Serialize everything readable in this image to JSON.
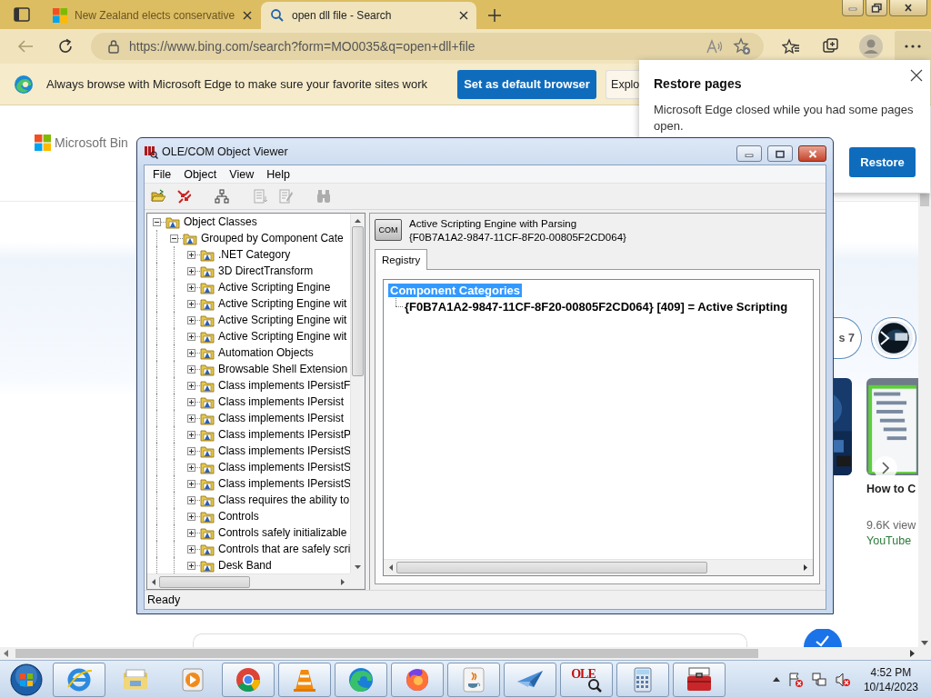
{
  "browser": {
    "tabs": [
      {
        "title": "New Zealand elects conservative",
        "kind": "news",
        "selected": false
      },
      {
        "title": "open dll file - Search",
        "kind": "search",
        "selected": true
      }
    ],
    "url": "https://www.bing.com/search?form=MO0035&q=open+dll+file",
    "info_bar": {
      "message": "Always browse with Microsoft Edge to make sure your favorite sites work",
      "buttons": [
        {
          "label": "Set as default browser",
          "kind": "primary"
        },
        {
          "label": "Explo",
          "kind": "secondary"
        }
      ]
    }
  },
  "restore_popup": {
    "title": "Restore pages",
    "message": "Microsoft Edge closed while you had some pages open.",
    "button": "Restore"
  },
  "page": {
    "logo": "Microsoft Bin",
    "pill": "s 7",
    "video": {
      "title": "How to C",
      "views": "9.6K view",
      "source": "YouTube"
    }
  },
  "ole_window": {
    "title": "OLE/COM Object Viewer",
    "menu": [
      "File",
      "Object",
      "View",
      "Help"
    ],
    "toolbar": [
      {
        "kind": "open-folder",
        "disabled": false
      },
      {
        "kind": "arrows",
        "disabled": false
      },
      {
        "kind": "hierarchy",
        "disabled": false
      },
      {
        "kind": "document",
        "disabled": true
      },
      {
        "kind": "document-edit",
        "disabled": true
      },
      {
        "kind": "binoculars",
        "disabled": true
      }
    ],
    "tree": [
      {
        "label": "Object Classes",
        "expanded": true,
        "children": [
          {
            "label": "Grouped by Component Cate",
            "expanded": true,
            "children": [
              {
                "label": ".NET Category",
                "expanded": false
              },
              {
                "label": "3D DirectTransform",
                "expanded": false
              },
              {
                "label": "Active Scripting Engine",
                "expanded": false
              },
              {
                "label": "Active Scripting Engine wit",
                "expanded": false
              },
              {
                "label": "Active Scripting Engine wit",
                "expanded": false
              },
              {
                "label": "Active Scripting Engine wit",
                "expanded": false
              },
              {
                "label": "Automation Objects",
                "expanded": false
              },
              {
                "label": "Browsable Shell Extension",
                "expanded": false
              },
              {
                "label": "Class implements IPersistF",
                "expanded": false
              },
              {
                "label": "Class implements IPersist",
                "expanded": false
              },
              {
                "label": "Class implements IPersist",
                "expanded": false
              },
              {
                "label": "Class implements IPersistP",
                "expanded": false
              },
              {
                "label": "Class implements IPersistS",
                "expanded": false
              },
              {
                "label": "Class implements IPersistS",
                "expanded": false
              },
              {
                "label": "Class implements IPersistS",
                "expanded": false
              },
              {
                "label": "Class requires the ability to",
                "expanded": false
              },
              {
                "label": "Controls",
                "expanded": false
              },
              {
                "label": "Controls safely initializable",
                "expanded": false
              },
              {
                "label": "Controls that are safely scri",
                "expanded": false
              },
              {
                "label": "Desk Band",
                "expanded": false
              }
            ]
          }
        ]
      }
    ],
    "detail": {
      "icon_label": "COM",
      "title": "Active Scripting Engine with Parsing",
      "clsid": "{F0B7A1A2-9847-11CF-8F20-00805F2CD064}",
      "tabs": [
        {
          "label": "Registry",
          "selected": true
        }
      ],
      "registry": [
        {
          "label": "Component Categories",
          "selected": true,
          "children": [
            {
              "label": "{F0B7A1A2-9847-11CF-8F20-00805F2CD064} [409] = Active Scripting",
              "selected": false
            }
          ]
        }
      ]
    },
    "status": "Ready"
  },
  "taskbar": {
    "apps": [
      {
        "kind": "ie",
        "running": true
      },
      {
        "kind": "explorer",
        "running": false
      },
      {
        "kind": "media",
        "running": false
      },
      {
        "kind": "chrome",
        "running": true
      },
      {
        "kind": "vlc",
        "running": true
      },
      {
        "kind": "edge",
        "running": true
      },
      {
        "kind": "firefox",
        "running": true
      },
      {
        "kind": "java",
        "running": true
      },
      {
        "kind": "plane",
        "running": true
      },
      {
        "kind": "ole",
        "label": "OLE",
        "running": true
      },
      {
        "kind": "calculator",
        "running": true
      },
      {
        "kind": "toolbox",
        "running": true
      }
    ],
    "clock": {
      "time": "4:52 PM",
      "date": "10/14/2023"
    }
  }
}
